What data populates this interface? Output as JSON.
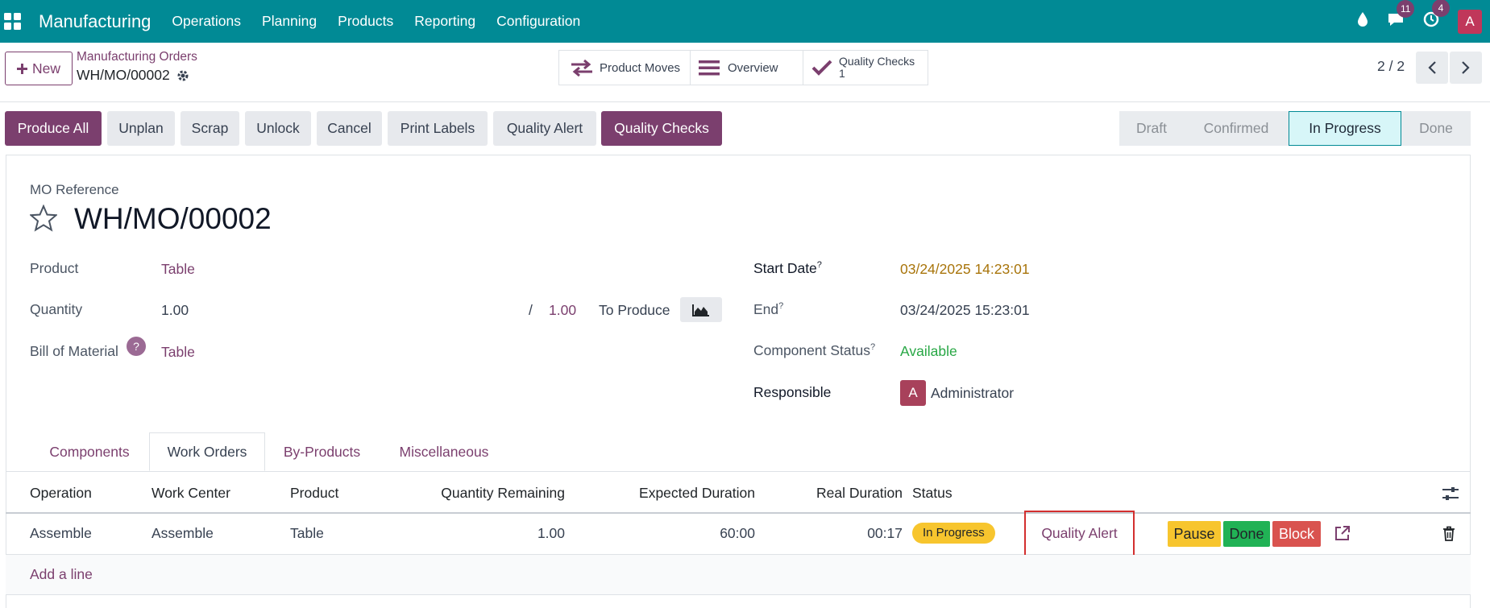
{
  "navbar": {
    "brand": "Manufacturing",
    "menus": [
      "Operations",
      "Planning",
      "Products",
      "Reporting",
      "Configuration"
    ],
    "messages_count": "11",
    "activities_count": "4",
    "user_initial": "A"
  },
  "control_panel": {
    "new_label": "New",
    "breadcrumb_parent": "Manufacturing Orders",
    "breadcrumb_current": "WH/MO/00002",
    "smart_buttons": {
      "product_moves": "Product Moves",
      "overview": "Overview",
      "quality_checks": "Quality Checks",
      "quality_checks_count": "1"
    },
    "pager": "2 / 2"
  },
  "actions": {
    "produce_all": "Produce All",
    "unplan": "Unplan",
    "scrap": "Scrap",
    "unlock": "Unlock",
    "cancel": "Cancel",
    "print_labels": "Print Labels",
    "quality_alert": "Quality Alert",
    "quality_checks": "Quality Checks"
  },
  "statusbar": {
    "stages": [
      "Draft",
      "Confirmed",
      "In Progress",
      "Done"
    ],
    "active": "In Progress"
  },
  "form": {
    "ref_label": "MO Reference",
    "reference": "WH/MO/00002",
    "product_label": "Product",
    "product": "Table",
    "quantity_label": "Quantity",
    "quantity": "1.00",
    "quantity_slash": "/",
    "quantity_total": "1.00",
    "to_produce": "To Produce",
    "bom_label": "Bill of Material",
    "bom_help": "?",
    "bom": "Table",
    "start_date_label": "Start Date",
    "start_date": "03/24/2025 14:23:01",
    "end_label": "End",
    "end": "03/24/2025 15:23:01",
    "component_status_label": "Component Status",
    "component_status": "Available",
    "responsible_label": "Responsible",
    "responsible": "Administrator",
    "responsible_initial": "A",
    "help_mark": "?"
  },
  "tabs": [
    "Components",
    "Work Orders",
    "By-Products",
    "Miscellaneous"
  ],
  "active_tab": "Work Orders",
  "workorders": {
    "columns": [
      "Operation",
      "Work Center",
      "Product",
      "Quantity Remaining",
      "Expected Duration",
      "Real Duration",
      "Status"
    ],
    "rows": [
      {
        "operation": "Assemble",
        "work_center": "Assemble",
        "product": "Table",
        "quantity_remaining": "1.00",
        "expected_duration": "60:00",
        "real_duration": "00:17",
        "status": "In Progress",
        "quality_alert": "Quality Alert",
        "pause": "Pause",
        "done": "Done",
        "block": "Block"
      }
    ],
    "add_line": "Add a line"
  },
  "colors": {
    "navbar": "#018a95",
    "primary": "#7b3f6e",
    "status_in_progress": "#f7c52e",
    "date_warning": "#a8740a",
    "available": "#28a745",
    "done_button": "#21b255",
    "block_button": "#d9534f"
  }
}
